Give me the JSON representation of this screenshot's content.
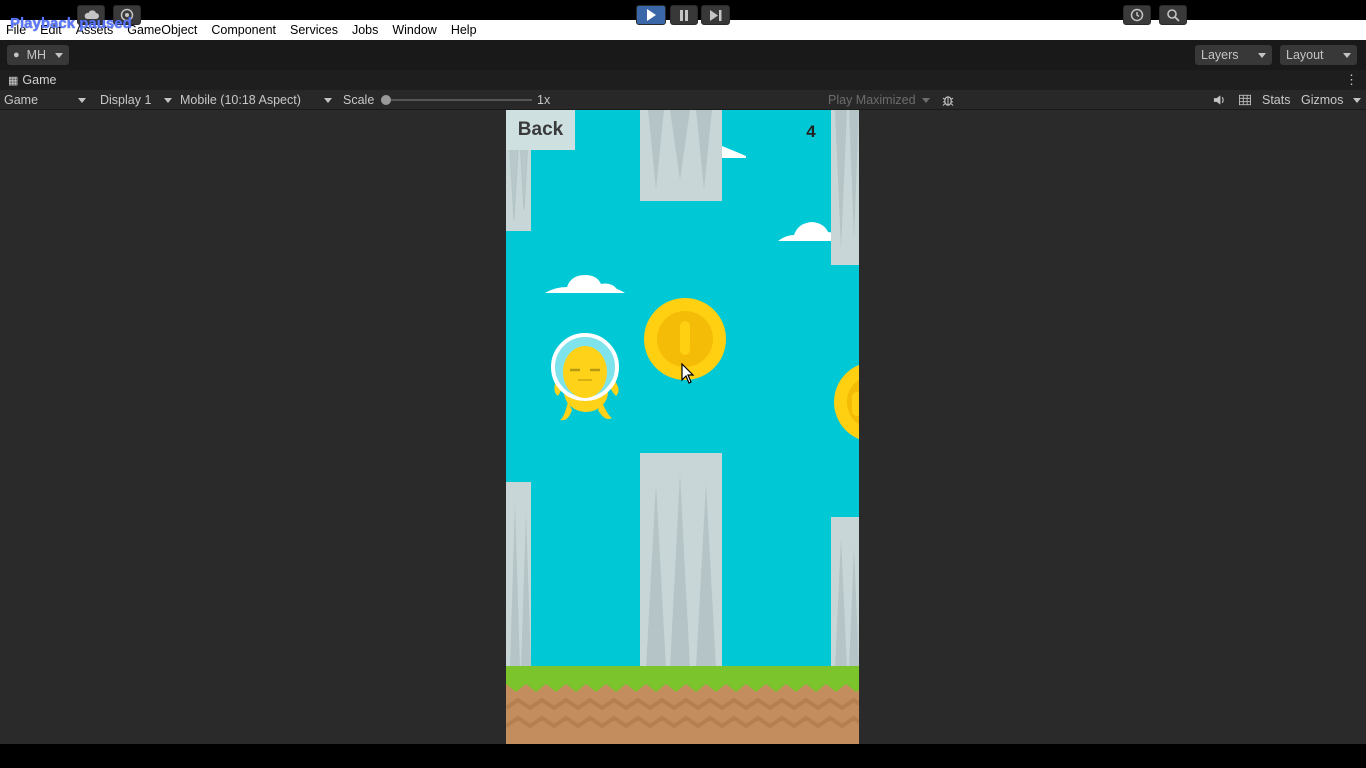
{
  "overlay": {
    "status": "Playback paused"
  },
  "menubar": {
    "items": [
      "File",
      "Edit",
      "Assets",
      "GameObject",
      "Component",
      "Services",
      "Jobs",
      "Window",
      "Help"
    ]
  },
  "toolbar": {
    "account_label": "MH",
    "layers_label": "Layers",
    "layout_label": "Layout"
  },
  "tab": {
    "label": "Game"
  },
  "gamebar": {
    "mode": "Game",
    "display": "Display 1",
    "aspect": "Mobile (10:18 Aspect)",
    "scale_label": "Scale",
    "scale_value": "1x",
    "play_maximized": "Play Maximized",
    "stats": "Stats",
    "gizmos": "Gizmos"
  },
  "game": {
    "back_label": "Back",
    "score": "4"
  },
  "colors": {
    "sky": "#00c8d4",
    "pillar": "#c8d6d8",
    "coin": "#ffd012",
    "player": "#ffd21a",
    "grass": "#7cc42b",
    "dirt": "#c48d5d",
    "play_button": "#3b67a8"
  },
  "icons": {
    "account": "user-icon",
    "cloud": "cloud-icon",
    "collab": "collab-icon",
    "play": "play-icon",
    "pause": "pause-icon",
    "step": "step-icon",
    "history": "history-icon",
    "search": "search-icon",
    "tab": "gamepad-icon",
    "bug": "bug-icon",
    "audio": "speaker-icon",
    "grid": "grid-icon"
  }
}
